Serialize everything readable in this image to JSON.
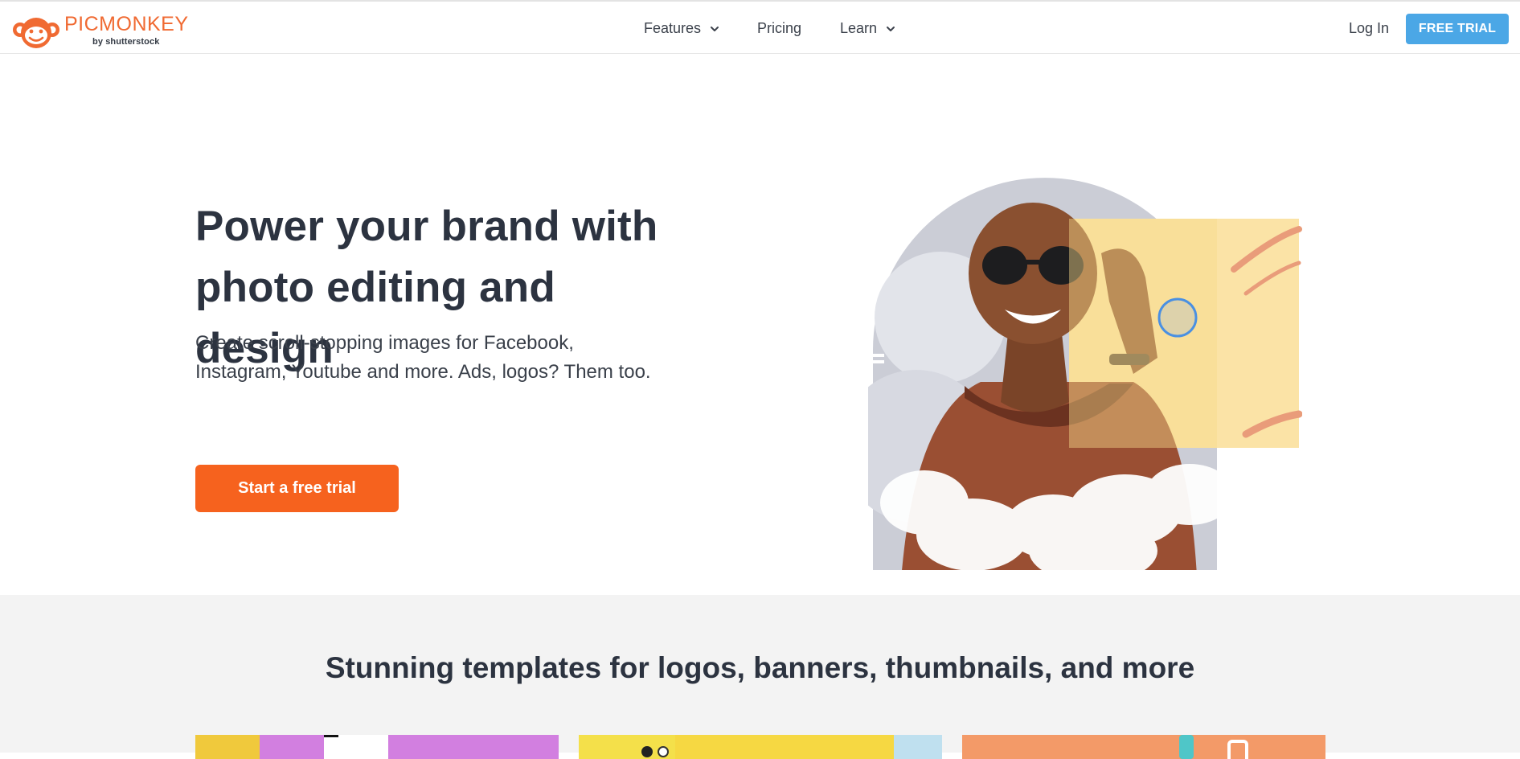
{
  "header": {
    "logo_text": "PICMONKEY",
    "logo_sub": "by shutterstock",
    "nav": [
      {
        "label": "Features",
        "has_dropdown": true
      },
      {
        "label": "Pricing",
        "has_dropdown": false
      },
      {
        "label": "Learn",
        "has_dropdown": true
      }
    ],
    "login_label": "Log In",
    "trial_label": "FREE TRIAL"
  },
  "hero": {
    "title_line1": "Power your brand with",
    "title_line2": "photo editing and design",
    "subtitle_line1": "Create scroll-stopping images for Facebook,",
    "subtitle_line2": "Instagram, Youtube and more. Ads, logos? Them too.",
    "cta_label": "Start a free trial"
  },
  "templates": {
    "title": "Stunning templates for logos, banners, thumbnails, and more"
  },
  "colors": {
    "brand_orange": "#f6621e",
    "logo_orange": "#f06a32",
    "trial_blue": "#4ba7e6",
    "text_dark": "#2c3340",
    "section_gray": "#f3f3f3"
  },
  "icons": {
    "logo": "monkey-face-icon",
    "dropdown": "chevron-down-icon"
  }
}
